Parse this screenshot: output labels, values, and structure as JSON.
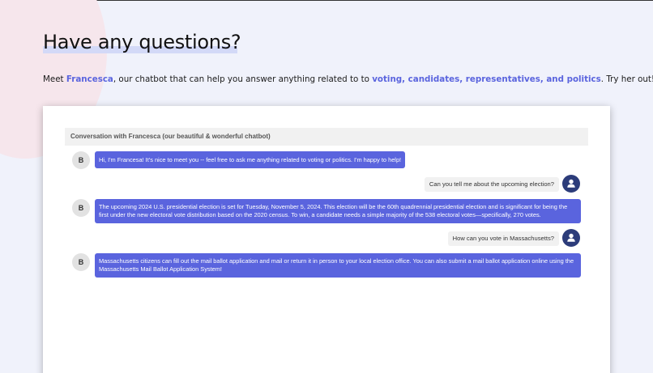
{
  "heading": "Have any questions?",
  "intro": {
    "text1": "Meet ",
    "bot_name": "Francesca",
    "text2": ", our chatbot that can help you answer anything related to to ",
    "topics": "voting, candidates, representatives, and politics",
    "text3": ". Try her out!"
  },
  "chat": {
    "header": "Conversation with Francesca (our beautiful & wonderful chatbot)",
    "bot_avatar_letter": "B",
    "messages": [
      {
        "sender": "bot",
        "text": "Hi, I'm Francesa! It's nice to meet you -- feel free to ask me anything related to voting or politics. I'm happy to help!"
      },
      {
        "sender": "user",
        "text": "Can you tell me about the upcoming election?"
      },
      {
        "sender": "bot",
        "text": "The upcoming 2024 U.S. presidential election is set for Tuesday, November 5, 2024. This election will be the 60th quadrennial presidential election and is significant for being the first under the new electoral vote distribution based on the 2020 census. To win, a candidate needs a simple majority of the 538 electoral votes—specifically, 270 votes."
      },
      {
        "sender": "user",
        "text": "How can you vote in Massachusetts?"
      },
      {
        "sender": "bot",
        "text": "Massachusetts citizens can fill out the mail ballot application and mail or return it in person to your local election office. You can also submit a mail ballot application online using the Massachusetts Mail Ballot Application System!"
      }
    ]
  },
  "colors": {
    "accent": "#5a64de",
    "user_avatar": "#2c3c7a",
    "page_background": "#f0f2fb"
  },
  "icons": {
    "user_avatar": "user-silhouette-icon"
  }
}
